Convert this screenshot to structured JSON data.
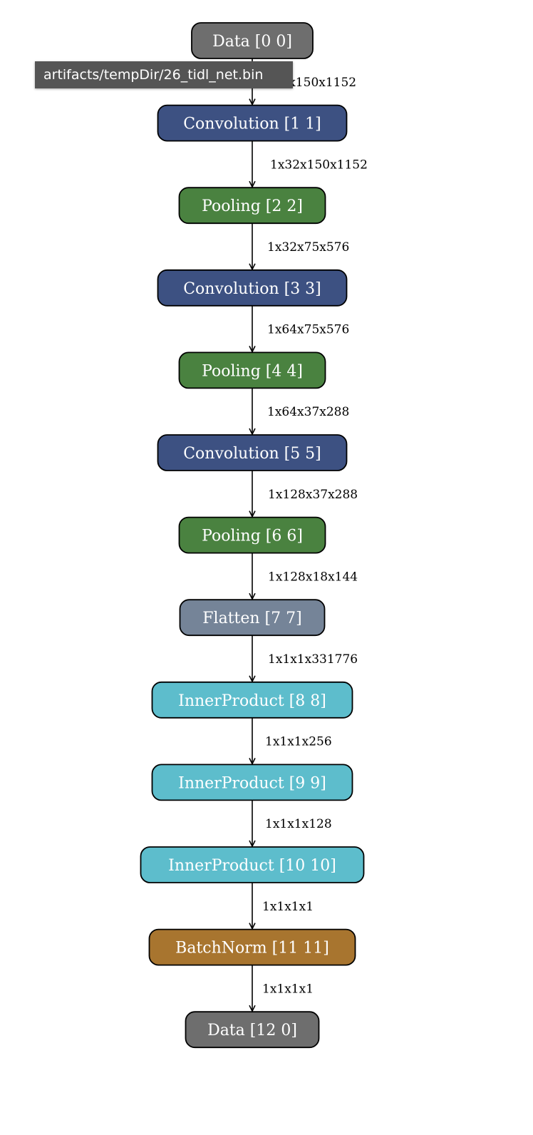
{
  "colors": {
    "data": "#6e6e6e",
    "convolution": "#3d5182",
    "pooling": "#4a8240",
    "flatten": "#758498",
    "innerproduct": "#5dbdcc",
    "batchnorm": "#a8752f",
    "stroke": "#000000",
    "text": "#ffffff"
  },
  "nodes": [
    {
      "label": "Data [0 0]",
      "type": "data"
    },
    {
      "label": "Convolution [1 1]",
      "type": "convolution"
    },
    {
      "label": "Pooling [2 2]",
      "type": "pooling"
    },
    {
      "label": "Convolution [3 3]",
      "type": "convolution"
    },
    {
      "label": "Pooling [4 4]",
      "type": "pooling"
    },
    {
      "label": "Convolution [5 5]",
      "type": "convolution"
    },
    {
      "label": "Pooling [6 6]",
      "type": "pooling"
    },
    {
      "label": "Flatten [7 7]",
      "type": "flatten"
    },
    {
      "label": "InnerProduct [8 8]",
      "type": "innerproduct"
    },
    {
      "label": "InnerProduct [9 9]",
      "type": "innerproduct"
    },
    {
      "label": "InnerProduct [10 10]",
      "type": "innerproduct"
    },
    {
      "label": "BatchNorm [11 11]",
      "type": "batchnorm"
    },
    {
      "label": "Data [12 0]",
      "type": "data"
    }
  ],
  "edges": [
    {
      "label": "1x3x150x1152"
    },
    {
      "label": "1x32x150x1152"
    },
    {
      "label": "1x32x75x576"
    },
    {
      "label": "1x64x75x576"
    },
    {
      "label": "1x64x37x288"
    },
    {
      "label": "1x128x37x288"
    },
    {
      "label": "1x128x18x144"
    },
    {
      "label": "1x1x1x331776"
    },
    {
      "label": "1x1x1x256"
    },
    {
      "label": "1x1x1x128"
    },
    {
      "label": "1x1x1x1"
    },
    {
      "label": "1x1x1x1"
    }
  ],
  "tooltip": {
    "text": "artifacts/tempDir/26_tidl_net.bin"
  }
}
